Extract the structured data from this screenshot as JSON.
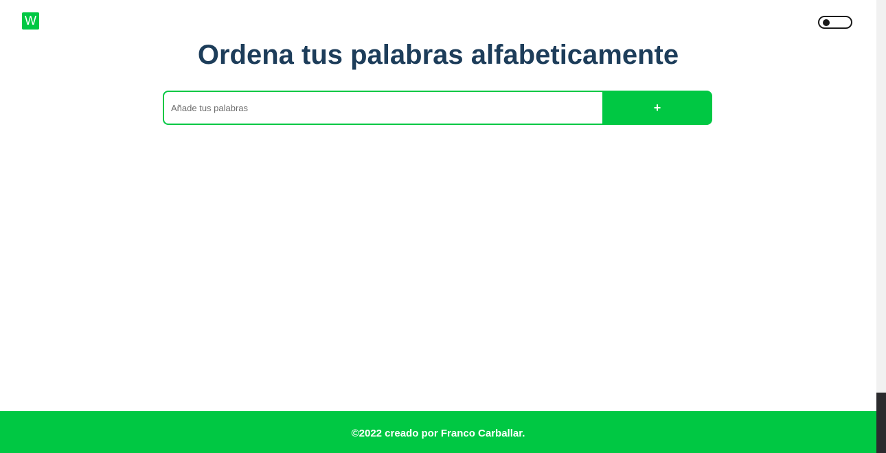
{
  "header": {
    "logo_letter": "W",
    "theme_toggle": {
      "state": "off"
    }
  },
  "main": {
    "title": "Ordena tus palabras alfabeticamente",
    "input": {
      "placeholder": "Añade tus palabras",
      "value": ""
    },
    "add_button_label": "+",
    "word_list": []
  },
  "footer": {
    "text": "©2022 creado por Franco Carballar."
  },
  "colors": {
    "accent": "#00c843",
    "title": "#1d3d5a",
    "background": "#ffffff",
    "toggle": "#1a1a1a",
    "scrollbar_track": "#2b2b2e"
  }
}
